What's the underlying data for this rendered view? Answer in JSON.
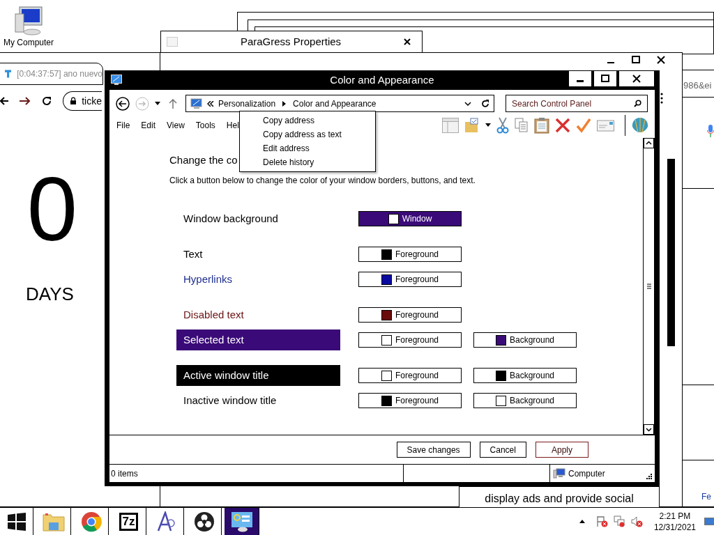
{
  "desktop_icons": [
    {
      "label": "My Computer"
    }
  ],
  "paragress_window": {
    "title": "ParaGress Properties"
  },
  "browser_left": {
    "tab_title": "[0:04:37:57] ano nuevo",
    "address": "ticke",
    "countdown": "0",
    "unit": "DAYS"
  },
  "browser_right": {
    "address": "986&ei",
    "cookie_text": "display ads and provide social",
    "link": "Fe"
  },
  "main_window": {
    "title": "Color and Appearance",
    "breadcrumb": [
      "Personalization",
      "Color and Appearance"
    ],
    "search": {
      "placeholder": "Search Control Panel"
    },
    "menu": [
      "File",
      "Edit",
      "View",
      "Tools",
      "Hel"
    ],
    "heading": "Change the co",
    "description": "Click a button below to change the color of your window borders, buttons, and text.",
    "groups": [
      [
        {
          "label": "Window background",
          "kind": "plain",
          "buttons": [
            {
              "label": "Window",
              "color": "#ffffff",
              "selected": true
            }
          ]
        }
      ],
      [
        {
          "label": "Text",
          "kind": "plain",
          "buttons": [
            {
              "label": "Foreground",
              "color": "#000000",
              "selected": false
            }
          ]
        },
        {
          "label": "Hyperlinks",
          "kind": "link",
          "buttons": [
            {
              "label": "Foreground",
              "color": "#0a0aa0",
              "selected": false
            }
          ]
        }
      ],
      [
        {
          "label": "Disabled text",
          "kind": "disabled",
          "buttons": [
            {
              "label": "Foreground",
              "color": "#6a0a0a",
              "selected": false
            }
          ]
        },
        {
          "label": "Selected text",
          "kind": "highlight",
          "buttons": [
            {
              "label": "Foreground",
              "color": "#ffffff",
              "selected": false
            },
            {
              "label": "Background",
              "color": "#3a0a78",
              "selected": false
            }
          ]
        }
      ],
      [
        {
          "label": "Active window title",
          "kind": "title",
          "buttons": [
            {
              "label": "Foreground",
              "color": "#ffffff",
              "selected": false
            },
            {
              "label": "Background",
              "color": "#000000",
              "selected": false
            }
          ]
        },
        {
          "label": "Inactive window title",
          "kind": "plain",
          "buttons": [
            {
              "label": "Foreground",
              "color": "#000000",
              "selected": false
            },
            {
              "label": "Background",
              "color": "#ffffff",
              "selected": false
            }
          ]
        }
      ]
    ],
    "footer_buttons": [
      {
        "label": "Save changes",
        "kind": "normal"
      },
      {
        "label": "Cancel",
        "kind": "normal"
      },
      {
        "label": "Apply",
        "kind": "default"
      }
    ],
    "status": {
      "items": "0 items",
      "location": "Computer"
    }
  },
  "context_menu": [
    "Copy address",
    "Copy address as text",
    "Edit address",
    "Delete history"
  ],
  "taskbar": {
    "apps": [
      {
        "kind": "start",
        "selected": false
      },
      {
        "kind": "explorer",
        "selected": false
      },
      {
        "kind": "chrome",
        "selected": false
      },
      {
        "kind": "sevenzip",
        "glyph": "7z",
        "selected": false
      },
      {
        "kind": "font",
        "selected": false
      },
      {
        "kind": "obs",
        "selected": false
      },
      {
        "kind": "control_panel",
        "selected": true
      }
    ],
    "time": "2:21 PM",
    "date": "12/31/2021"
  }
}
